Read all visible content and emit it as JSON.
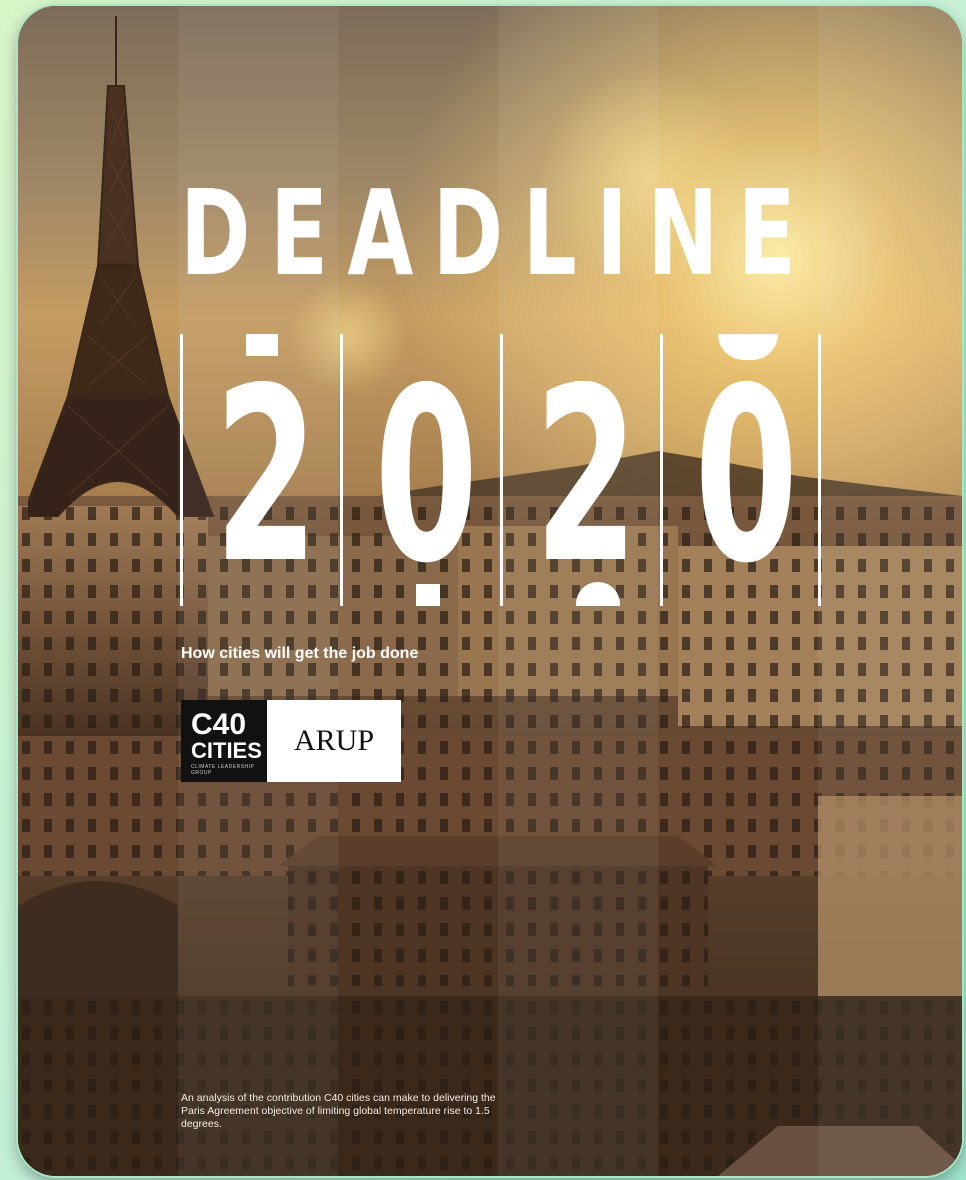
{
  "cover": {
    "title": "DEADLINE",
    "year_digits": [
      "2",
      "0",
      "2",
      "0"
    ],
    "subtitle": "How cities will get the job done",
    "logos": {
      "c40_line1": "C40",
      "c40_line2": "CITIES",
      "c40_tagline": "CLIMATE LEADERSHIP GROUP",
      "partner": "ARUP"
    },
    "description": "An analysis of the contribution C40 cities can make to delivering the Paris Agreement objective of limiting global temperature rise to 1.5 degrees."
  },
  "colors": {
    "title_text": "#ffffff",
    "logo_dark_bg": "#111111",
    "logo_light_bg": "#ffffff",
    "frame_border": "#a8e6c6"
  },
  "image": {
    "scene": "paris-rooftops-eiffel-tower-sunset"
  }
}
